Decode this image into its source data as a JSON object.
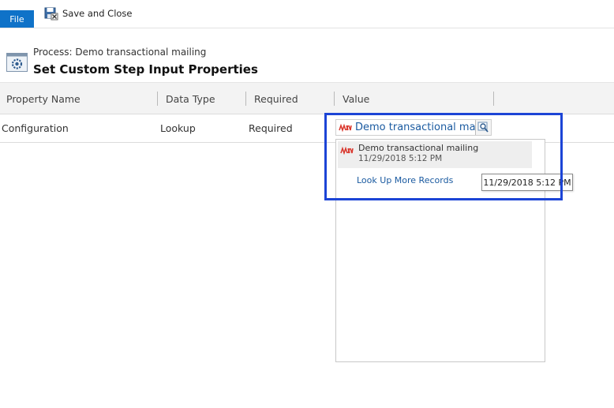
{
  "ribbon": {
    "file_label": "File",
    "save_close_label": "Save and Close"
  },
  "header": {
    "process_label": "Process: Demo transactional mailing",
    "title": "Set Custom Step Input Properties"
  },
  "grid": {
    "columns": [
      "Property Name",
      "Data Type",
      "Required",
      "Value"
    ],
    "rows": [
      {
        "property_name": "Configuration",
        "data_type": "Lookup",
        "required": "Required",
        "value": "Demo transactional mailing"
      }
    ]
  },
  "dropdown": {
    "items": [
      {
        "name": "Demo transactional mailing",
        "date": "11/29/2018 5:12 PM"
      }
    ],
    "more_records_label": "Look Up More Records"
  },
  "tooltip": {
    "text": "11/29/2018 5:12 PM"
  },
  "colors": {
    "file_tab": "#0f72c8",
    "link": "#1a5aa0",
    "highlight": "#1c44d6",
    "entity_icon": "#d9352b"
  },
  "icons": {
    "save_close": "save-close-icon",
    "process": "process-gear-icon",
    "entity": "mailing-entity-icon",
    "lookup": "lookup-magnifier-icon"
  }
}
